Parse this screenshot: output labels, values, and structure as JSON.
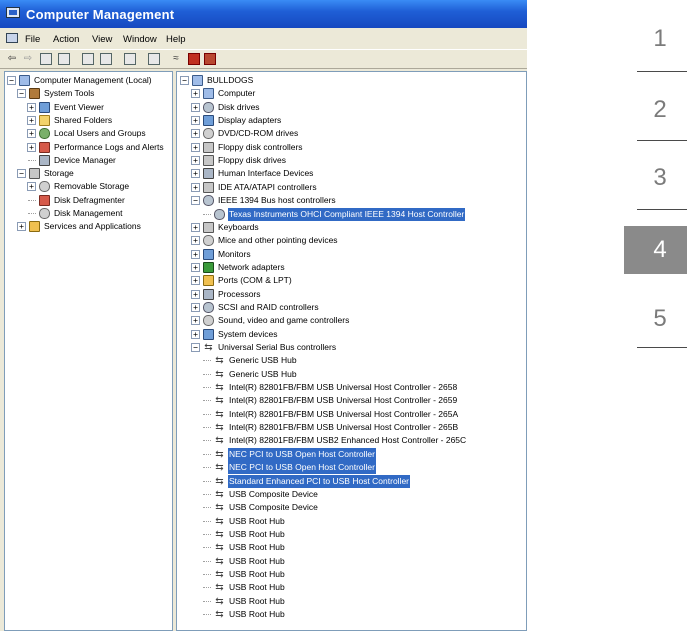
{
  "window": {
    "title": "Computer Management",
    "menu": [
      "File",
      "Action",
      "View",
      "Window",
      "Help"
    ]
  },
  "left_tree": [
    {
      "label": "Computer Management (Local)",
      "level": 0,
      "icon": "computer-icon",
      "expander": "minus"
    },
    {
      "label": "System Tools",
      "level": 1,
      "icon": "tools-icon",
      "expander": "minus"
    },
    {
      "label": "Event Viewer",
      "level": 2,
      "icon": "event-viewer-icon",
      "expander": "plus"
    },
    {
      "label": "Shared Folders",
      "level": 2,
      "icon": "folder-icon",
      "expander": "plus"
    },
    {
      "label": "Local Users and Groups",
      "level": 2,
      "icon": "users-icon",
      "expander": "plus"
    },
    {
      "label": "Performance Logs and Alerts",
      "level": 2,
      "icon": "performance-icon",
      "expander": "plus"
    },
    {
      "label": "Device Manager",
      "level": 2,
      "icon": "device-manager-icon",
      "expander": "none"
    },
    {
      "label": "Storage",
      "level": 1,
      "icon": "storage-icon",
      "expander": "minus"
    },
    {
      "label": "Removable Storage",
      "level": 2,
      "icon": "removable-storage-icon",
      "expander": "plus"
    },
    {
      "label": "Disk Defragmenter",
      "level": 2,
      "icon": "defrag-icon",
      "expander": "none"
    },
    {
      "label": "Disk Management",
      "level": 2,
      "icon": "disk-management-icon",
      "expander": "none"
    },
    {
      "label": "Services and Applications",
      "level": 1,
      "icon": "services-icon",
      "expander": "plus"
    }
  ],
  "right_tree": [
    {
      "label": "BULLDOGS",
      "level": 0,
      "icon": "computer-icon",
      "expander": "minus"
    },
    {
      "label": "Computer",
      "level": 1,
      "icon": "computer-icon",
      "expander": "plus"
    },
    {
      "label": "Disk drives",
      "level": 1,
      "icon": "disk-drive-icon",
      "expander": "plus"
    },
    {
      "label": "Display adapters",
      "level": 1,
      "icon": "display-adapter-icon",
      "expander": "plus"
    },
    {
      "label": "DVD/CD-ROM drives",
      "level": 1,
      "icon": "cdrom-icon",
      "expander": "plus"
    },
    {
      "label": "Floppy disk controllers",
      "level": 1,
      "icon": "floppy-controller-icon",
      "expander": "plus"
    },
    {
      "label": "Floppy disk drives",
      "level": 1,
      "icon": "floppy-drive-icon",
      "expander": "plus"
    },
    {
      "label": "Human Interface Devices",
      "level": 1,
      "icon": "hid-icon",
      "expander": "plus"
    },
    {
      "label": "IDE ATA/ATAPI controllers",
      "level": 1,
      "icon": "ide-icon",
      "expander": "plus"
    },
    {
      "label": "IEEE 1394 Bus host controllers",
      "level": 1,
      "icon": "ieee1394-icon",
      "expander": "minus"
    },
    {
      "label": "Texas Instruments OHCI Compliant IEEE 1394 Host Controller",
      "level": 2,
      "icon": "ieee1394-icon",
      "expander": "none",
      "selected": true
    },
    {
      "label": "Keyboards",
      "level": 1,
      "icon": "keyboard-icon",
      "expander": "plus"
    },
    {
      "label": "Mice and other pointing devices",
      "level": 1,
      "icon": "mouse-icon",
      "expander": "plus"
    },
    {
      "label": "Monitors",
      "level": 1,
      "icon": "monitor-icon",
      "expander": "plus"
    },
    {
      "label": "Network adapters",
      "level": 1,
      "icon": "network-icon",
      "expander": "plus"
    },
    {
      "label": "Ports (COM & LPT)",
      "level": 1,
      "icon": "port-icon",
      "expander": "plus"
    },
    {
      "label": "Processors",
      "level": 1,
      "icon": "processor-icon",
      "expander": "plus"
    },
    {
      "label": "SCSI and RAID controllers",
      "level": 1,
      "icon": "scsi-icon",
      "expander": "plus"
    },
    {
      "label": "Sound, video and game controllers",
      "level": 1,
      "icon": "sound-icon",
      "expander": "plus"
    },
    {
      "label": "System devices",
      "level": 1,
      "icon": "system-device-icon",
      "expander": "plus"
    },
    {
      "label": "Universal Serial Bus controllers",
      "level": 1,
      "icon": "usb-icon",
      "expander": "minus"
    },
    {
      "label": "Generic USB Hub",
      "level": 2,
      "icon": "usb-icon",
      "expander": "none"
    },
    {
      "label": "Generic USB Hub",
      "level": 2,
      "icon": "usb-icon",
      "expander": "none"
    },
    {
      "label": "Intel(R) 82801FB/FBM USB Universal Host Controller - 2658",
      "level": 2,
      "icon": "usb-icon",
      "expander": "none"
    },
    {
      "label": "Intel(R) 82801FB/FBM USB Universal Host Controller - 2659",
      "level": 2,
      "icon": "usb-icon",
      "expander": "none"
    },
    {
      "label": "Intel(R) 82801FB/FBM USB Universal Host Controller - 265A",
      "level": 2,
      "icon": "usb-icon",
      "expander": "none"
    },
    {
      "label": "Intel(R) 82801FB/FBM USB Universal Host Controller - 265B",
      "level": 2,
      "icon": "usb-icon",
      "expander": "none"
    },
    {
      "label": "Intel(R) 82801FB/FBM USB2 Enhanced Host Controller - 265C",
      "level": 2,
      "icon": "usb-icon",
      "expander": "none"
    },
    {
      "label": "NEC PCI to USB Open Host Controller",
      "level": 2,
      "icon": "usb-icon",
      "expander": "none",
      "selected": true
    },
    {
      "label": "NEC PCI to USB Open Host Controller",
      "level": 2,
      "icon": "usb-icon",
      "expander": "none",
      "selected": true
    },
    {
      "label": "Standard Enhanced PCI to USB Host Controller",
      "level": 2,
      "icon": "usb-icon",
      "expander": "none",
      "selected": true
    },
    {
      "label": "USB Composite Device",
      "level": 2,
      "icon": "usb-icon",
      "expander": "none"
    },
    {
      "label": "USB Composite Device",
      "level": 2,
      "icon": "usb-icon",
      "expander": "none"
    },
    {
      "label": "USB Root Hub",
      "level": 2,
      "icon": "usb-icon",
      "expander": "none"
    },
    {
      "label": "USB Root Hub",
      "level": 2,
      "icon": "usb-icon",
      "expander": "none"
    },
    {
      "label": "USB Root Hub",
      "level": 2,
      "icon": "usb-icon",
      "expander": "none"
    },
    {
      "label": "USB Root Hub",
      "level": 2,
      "icon": "usb-icon",
      "expander": "none"
    },
    {
      "label": "USB Root Hub",
      "level": 2,
      "icon": "usb-icon",
      "expander": "none"
    },
    {
      "label": "USB Root Hub",
      "level": 2,
      "icon": "usb-icon",
      "expander": "none"
    },
    {
      "label": "USB Root Hub",
      "level": 2,
      "icon": "usb-icon",
      "expander": "none"
    },
    {
      "label": "USB Root Hub",
      "level": 2,
      "icon": "usb-icon",
      "expander": "none"
    }
  ],
  "steps": {
    "items": [
      "1",
      "2",
      "3",
      "4",
      "5"
    ],
    "active": "4"
  },
  "colors": {
    "titlebar": "#1f5fd6",
    "selection": "#316ac5",
    "active_step": "#8a8a8a"
  }
}
